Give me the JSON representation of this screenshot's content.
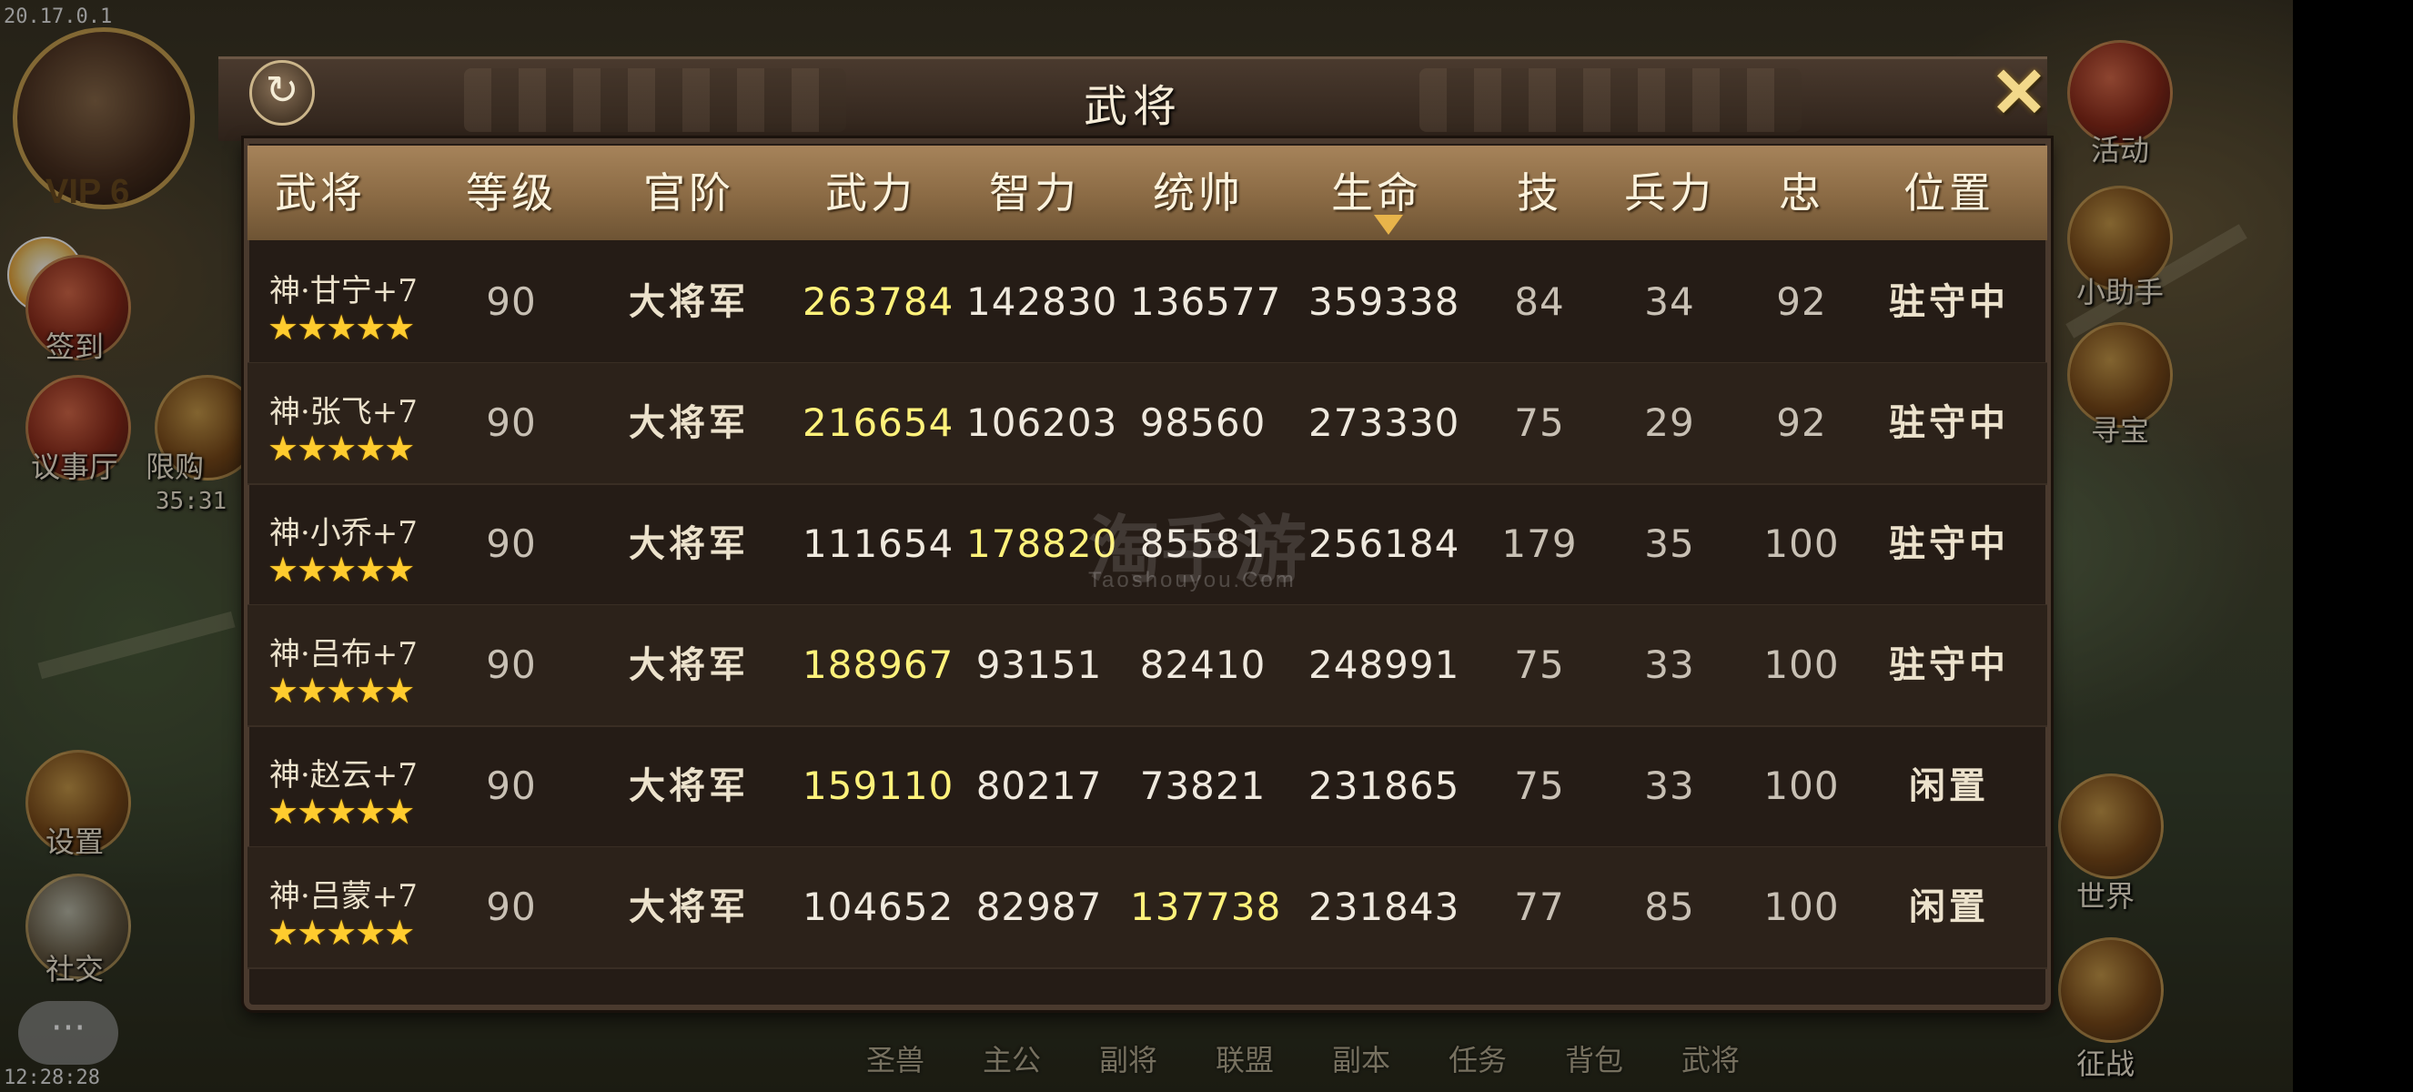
{
  "status": {
    "version": "20.17.0.1",
    "clock": "12:28:28"
  },
  "hud": {
    "vip": "VIP 6",
    "countdown": "35:31",
    "left_menu": [
      "签到",
      "议事厅",
      "限购",
      "设置",
      "社交"
    ],
    "right_menu": [
      "活动",
      "小助手",
      "寻宝",
      "世界",
      "征战"
    ],
    "bottom_menu": [
      "圣兽",
      "主公",
      "副将",
      "联盟",
      "副本",
      "任务",
      "背包",
      "武将"
    ],
    "chat_label": "···"
  },
  "dialog": {
    "title": "武将",
    "refresh_label": "↻",
    "close_label": "✕",
    "sort_column": "生命",
    "columns": [
      "武将",
      "等级",
      "官阶",
      "武力",
      "智力",
      "统帅",
      "生命",
      "技",
      "兵力",
      "忠",
      "位置"
    ],
    "rows": [
      {
        "name": "神·甘宁+7",
        "stars": "★★★★★",
        "level": "90",
        "rank": "大将军",
        "force": "263784",
        "intel": "142830",
        "command": "136577",
        "hp": "359338",
        "skill": "84",
        "troops": "34",
        "loyalty": "92",
        "position": "驻守中",
        "highlight": "force"
      },
      {
        "name": "神·张飞+7",
        "stars": "★★★★★",
        "level": "90",
        "rank": "大将军",
        "force": "216654",
        "intel": "106203",
        "command": "98560",
        "hp": "273330",
        "skill": "75",
        "troops": "29",
        "loyalty": "92",
        "position": "驻守中",
        "highlight": "force"
      },
      {
        "name": "神·小乔+7",
        "stars": "★★★★★",
        "level": "90",
        "rank": "大将军",
        "force": "111654",
        "intel": "178820",
        "command": "85581",
        "hp": "256184",
        "skill": "179",
        "troops": "35",
        "loyalty": "100",
        "position": "驻守中",
        "highlight": "intel"
      },
      {
        "name": "神·吕布+7",
        "stars": "★★★★★",
        "level": "90",
        "rank": "大将军",
        "force": "188967",
        "intel": "93151",
        "command": "82410",
        "hp": "248991",
        "skill": "75",
        "troops": "33",
        "loyalty": "100",
        "position": "驻守中",
        "highlight": "force"
      },
      {
        "name": "神·赵云+7",
        "stars": "★★★★★",
        "level": "90",
        "rank": "大将军",
        "force": "159110",
        "intel": "80217",
        "command": "73821",
        "hp": "231865",
        "skill": "75",
        "troops": "33",
        "loyalty": "100",
        "position": "闲置",
        "highlight": "force"
      },
      {
        "name": "神·吕蒙+7",
        "stars": "★★★★★",
        "level": "90",
        "rank": "大将军",
        "force": "104652",
        "intel": "82987",
        "command": "137738",
        "hp": "231843",
        "skill": "77",
        "troops": "85",
        "loyalty": "100",
        "position": "闲置",
        "highlight": "command"
      }
    ]
  },
  "watermark": {
    "main": "淘手游",
    "sub": "Taoshouyou.Com"
  },
  "colors": {
    "highlight": "#fff27a",
    "header_bg": "#8a6a44",
    "table_bg": "#251c16",
    "star": "#ffcc2e"
  }
}
